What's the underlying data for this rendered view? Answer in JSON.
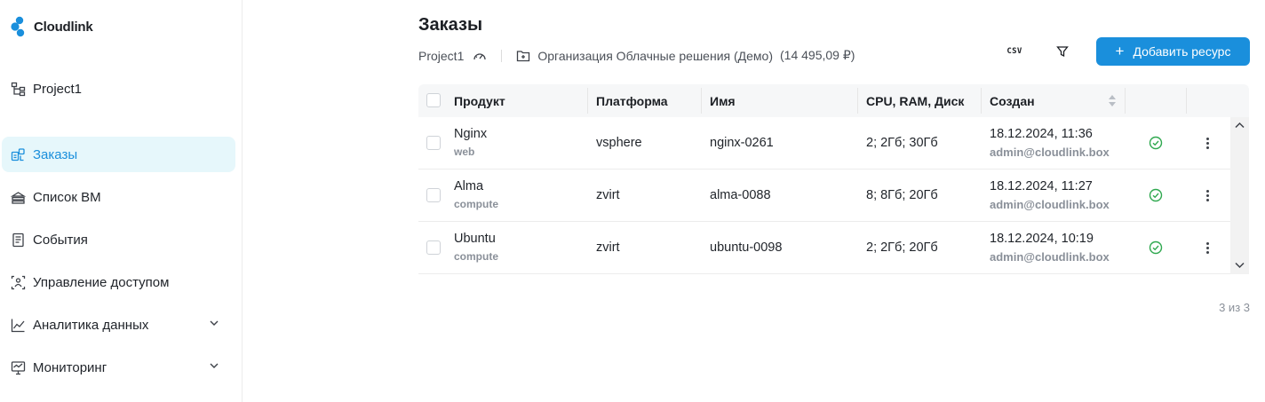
{
  "app": {
    "name": "Cloudlink",
    "brand_color": "#1a8fdc"
  },
  "sidebar": {
    "project": "Project1",
    "items": [
      {
        "label": "Заказы",
        "icon": "orders-icon",
        "active": true
      },
      {
        "label": "Список ВМ",
        "icon": "vm-list-icon",
        "active": false
      },
      {
        "label": "События",
        "icon": "events-icon",
        "active": false
      },
      {
        "label": "Управление доступом",
        "icon": "access-icon",
        "active": false
      },
      {
        "label": "Аналитика данных",
        "icon": "analytics-icon",
        "active": false,
        "expandable": true
      },
      {
        "label": "Мониторинг",
        "icon": "monitoring-icon",
        "active": false,
        "expandable": true
      }
    ]
  },
  "header": {
    "title": "Заказы",
    "project": "Project1",
    "organization": "Организация Облачные решения (Демо)",
    "balance": "(14 495,09 ₽)"
  },
  "toolbar": {
    "csv_label": "CSV",
    "add_label": "Добавить ресурс"
  },
  "table": {
    "columns": [
      "Продукт",
      "Платформа",
      "Имя",
      "CPU, RAM, Диск",
      "Создан"
    ],
    "rows": [
      {
        "product": "Nginx",
        "type": "web",
        "platform": "vsphere",
        "name": "nginx-0261",
        "resources": "2; 2Гб; 30Гб",
        "created": "18.12.2024, 11:36",
        "user": "admin@cloudlink.box",
        "status": "ok"
      },
      {
        "product": "Alma",
        "type": "compute",
        "platform": "zvirt",
        "name": "alma-0088",
        "resources": "8; 8Гб; 20Гб",
        "created": "18.12.2024, 11:27",
        "user": "admin@cloudlink.box",
        "status": "ok"
      },
      {
        "product": "Ubuntu",
        "type": "compute",
        "platform": "zvirt",
        "name": "ubuntu-0098",
        "resources": "2; 2Гб; 20Гб",
        "created": "18.12.2024, 10:19",
        "user": "admin@cloudlink.box",
        "status": "ok"
      }
    ]
  },
  "pager": {
    "text": "3 из 3"
  },
  "colors": {
    "status_ok": "#2fa84f",
    "active_bg": "#e6f7fb"
  }
}
